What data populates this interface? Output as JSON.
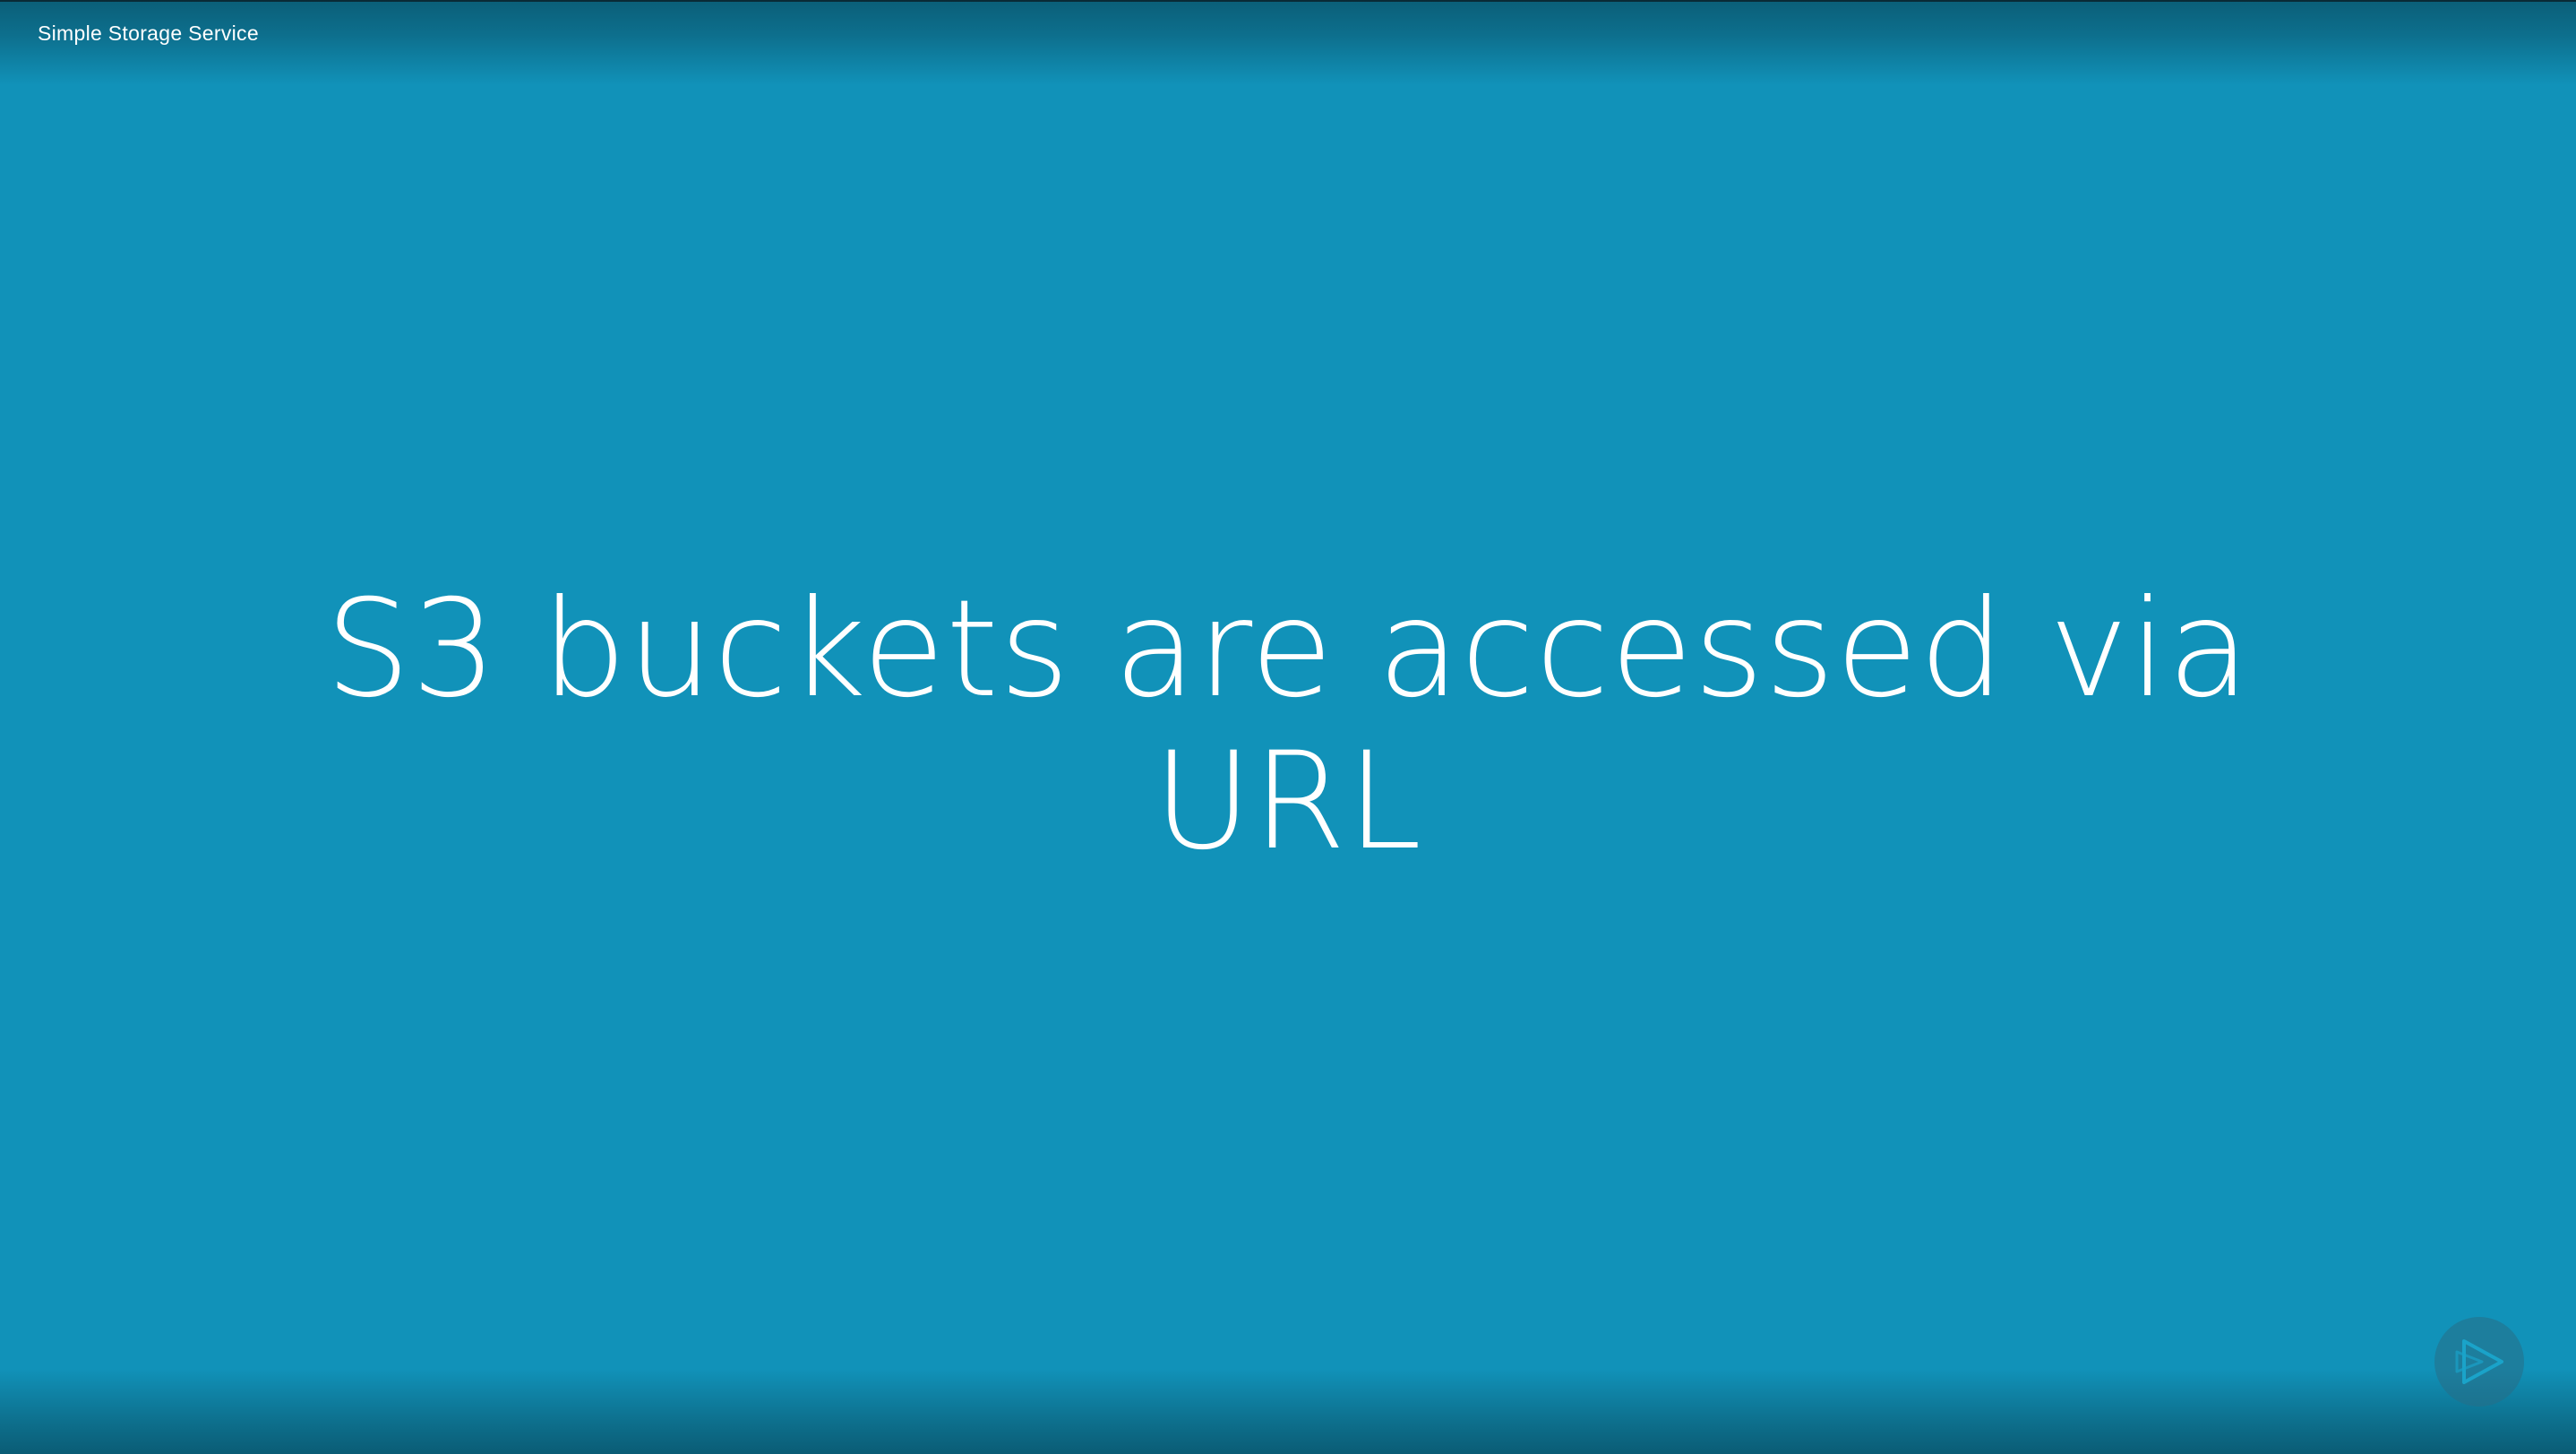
{
  "header": {
    "module_title": "Simple Storage Service"
  },
  "slide": {
    "line1": "S3 buckets are accessed via",
    "line2": "URL"
  },
  "controls": {
    "play_icon": "play-logo-icon"
  },
  "colors": {
    "background": "#1192b9",
    "text": "#ffffff"
  }
}
